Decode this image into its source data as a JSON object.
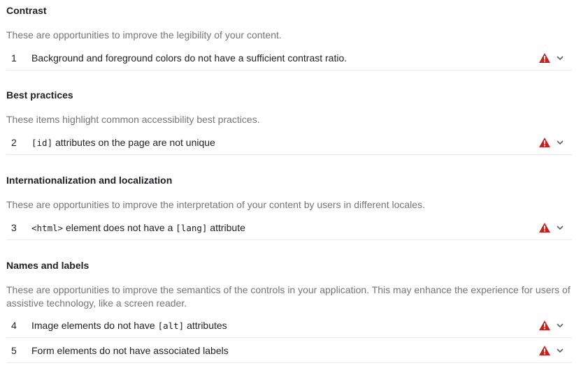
{
  "sections": [
    {
      "title": "Contrast",
      "description": "These are opportunities to improve the legibility of your content.",
      "audits": [
        {
          "index": "1",
          "parts": [
            {
              "text": "Background and foreground colors do not have a sufficient contrast ratio.",
              "code": false
            }
          ],
          "status_icon": "fail-triangle-icon"
        }
      ]
    },
    {
      "title": "Best practices",
      "description": "These items highlight common accessibility best practices.",
      "audits": [
        {
          "index": "2",
          "parts": [
            {
              "text": "[id]",
              "code": true
            },
            {
              "text": " attributes on the page are not unique",
              "code": false
            }
          ],
          "status_icon": "fail-triangle-icon"
        }
      ]
    },
    {
      "title": "Internationalization and localization",
      "description": "These are opportunities to improve the interpretation of your content by users in different locales.",
      "audits": [
        {
          "index": "3",
          "parts": [
            {
              "text": "<html>",
              "code": true
            },
            {
              "text": " element does not have a ",
              "code": false
            },
            {
              "text": "[lang]",
              "code": true
            },
            {
              "text": " attribute",
              "code": false
            }
          ],
          "status_icon": "fail-triangle-icon"
        }
      ]
    },
    {
      "title": "Names and labels",
      "description": "These are opportunities to improve the semantics of the controls in your application. This may enhance the experience for users of assistive technology, like a screen reader.",
      "audits": [
        {
          "index": "4",
          "parts": [
            {
              "text": "Image elements do not have ",
              "code": false
            },
            {
              "text": "[alt]",
              "code": true
            },
            {
              "text": " attributes",
              "code": false
            }
          ],
          "status_icon": "fail-triangle-icon"
        },
        {
          "index": "5",
          "parts": [
            {
              "text": "Form elements do not have associated labels",
              "code": false
            }
          ],
          "status_icon": "fail-triangle-icon"
        }
      ]
    }
  ],
  "colors": {
    "fail": "#c5221f",
    "chevron": "#5f6368",
    "description": "#757575",
    "divider": "#ebebeb"
  }
}
